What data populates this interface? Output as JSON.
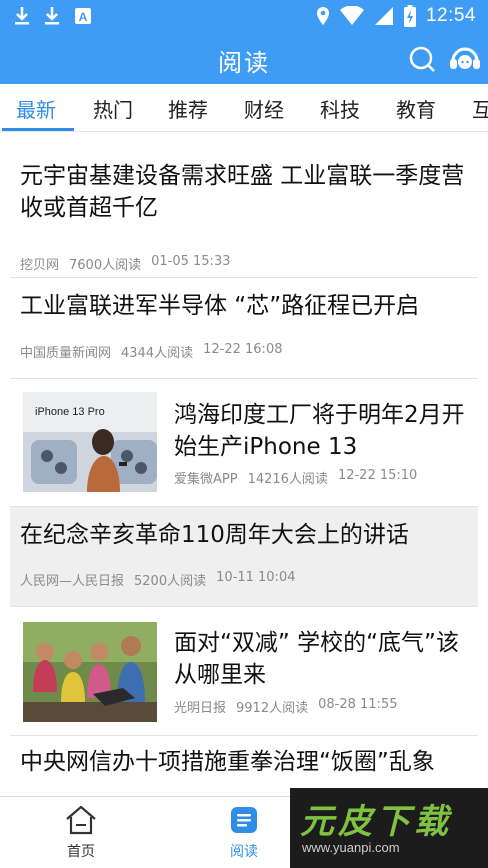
{
  "status_bar": {
    "time": "12:54",
    "left_icons": [
      "download-icon",
      "download-icon",
      "keyboard-a-icon"
    ],
    "right_icons": [
      "location-icon",
      "wifi-icon",
      "signal-icon",
      "battery-charging-icon"
    ]
  },
  "header": {
    "title": "阅读",
    "search_icon": "search-icon",
    "service_icon": "customer-service-icon"
  },
  "tabs": [
    {
      "label": "最新",
      "active": true
    },
    {
      "label": "热门"
    },
    {
      "label": "推荐"
    },
    {
      "label": "财经"
    },
    {
      "label": "科技"
    },
    {
      "label": "教育"
    },
    {
      "label": "互"
    }
  ],
  "articles": [
    {
      "title": "元宇宙基建设备需求旺盛 工业富联一季度营收或首超千亿",
      "source": "挖贝网",
      "reads": "7600人阅读",
      "time": "01-05 15:33"
    },
    {
      "title": "工业富联进军半导体 “芯”路征程已开启",
      "source": "中国质量新闻网",
      "reads": "4344人阅读",
      "time": "12-22 16:08"
    },
    {
      "title": "鸿海印度工厂将于明年2月开始生产iPhone 13",
      "source": "爱集微APP",
      "reads": "14216人阅读",
      "time": "12-22 15:10",
      "thumb_text": "iPhone 13 Pro"
    },
    {
      "title": "在纪念辛亥革命110周年大会上的讲话",
      "source": "人民网—人民日报",
      "reads": "5200人阅读",
      "time": "10-11 10:04"
    },
    {
      "title": "面对“双减” 学校的“底气”该从哪里来",
      "source": "光明日报",
      "reads": "9912人阅读",
      "time": "08-28 11:55"
    },
    {
      "title": "中央网信办十项措施重拳治理“饭圈”乱象"
    }
  ],
  "bottom_nav": [
    {
      "label": "首页",
      "icon": "home-icon"
    },
    {
      "label": "阅读",
      "icon": "reading-icon",
      "active": true
    }
  ],
  "watermark": {
    "main": "元皮下载",
    "sub": "www.yuanpi.com"
  },
  "colors": {
    "accent": "#3f9cf5",
    "tab_active": "#2f8de6",
    "meta": "#8a8a8a"
  }
}
